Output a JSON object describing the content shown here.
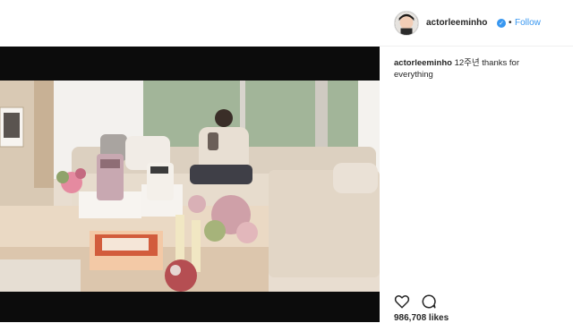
{
  "post": {
    "username": "actorleeminho",
    "follow_label": "Follow",
    "separator": "•",
    "caption_text": "12주년 thanks for everything",
    "likes": "986,708 likes"
  },
  "icons": {
    "verified": "verified-badge-icon",
    "like": "heart-icon",
    "comment": "comment-icon"
  },
  "colors": {
    "accent": "#3897f0",
    "frame": "#0c0c0c",
    "text": "#262626"
  }
}
